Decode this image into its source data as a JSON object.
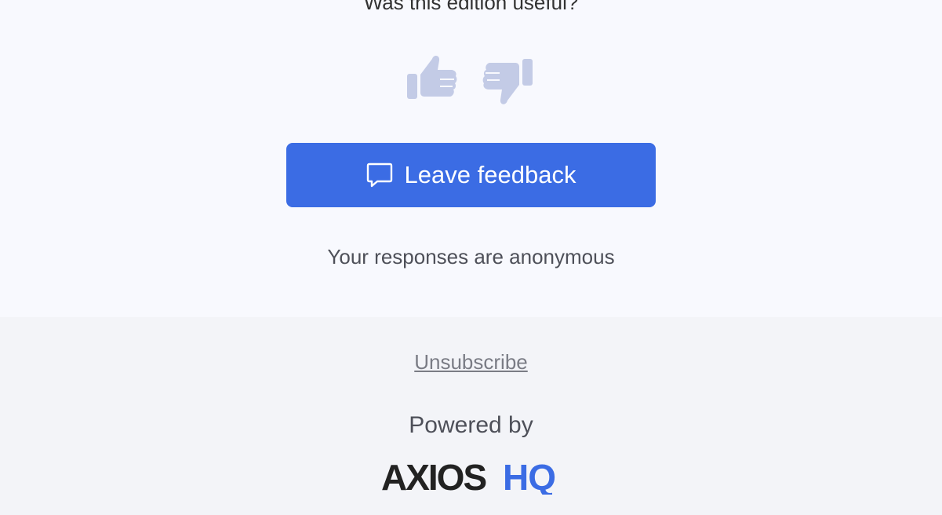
{
  "feedback": {
    "question": "Was this edition useful?",
    "thumbs_up_icon": "thumbs-up-icon",
    "thumbs_down_icon": "thumbs-down-icon",
    "button_icon": "chat-bubble-icon",
    "button_label": "Leave feedback",
    "note": "Your responses are anonymous"
  },
  "footer": {
    "unsubscribe": "Unsubscribe",
    "powered_by": "Powered by",
    "logo_word1": "AXIOS",
    "logo_word2": "HQ"
  },
  "colors": {
    "accent": "#3b6ce4",
    "thumb": "#c3cbe6",
    "logo_dark": "#222222",
    "logo_blue": "#3b6ce4"
  }
}
